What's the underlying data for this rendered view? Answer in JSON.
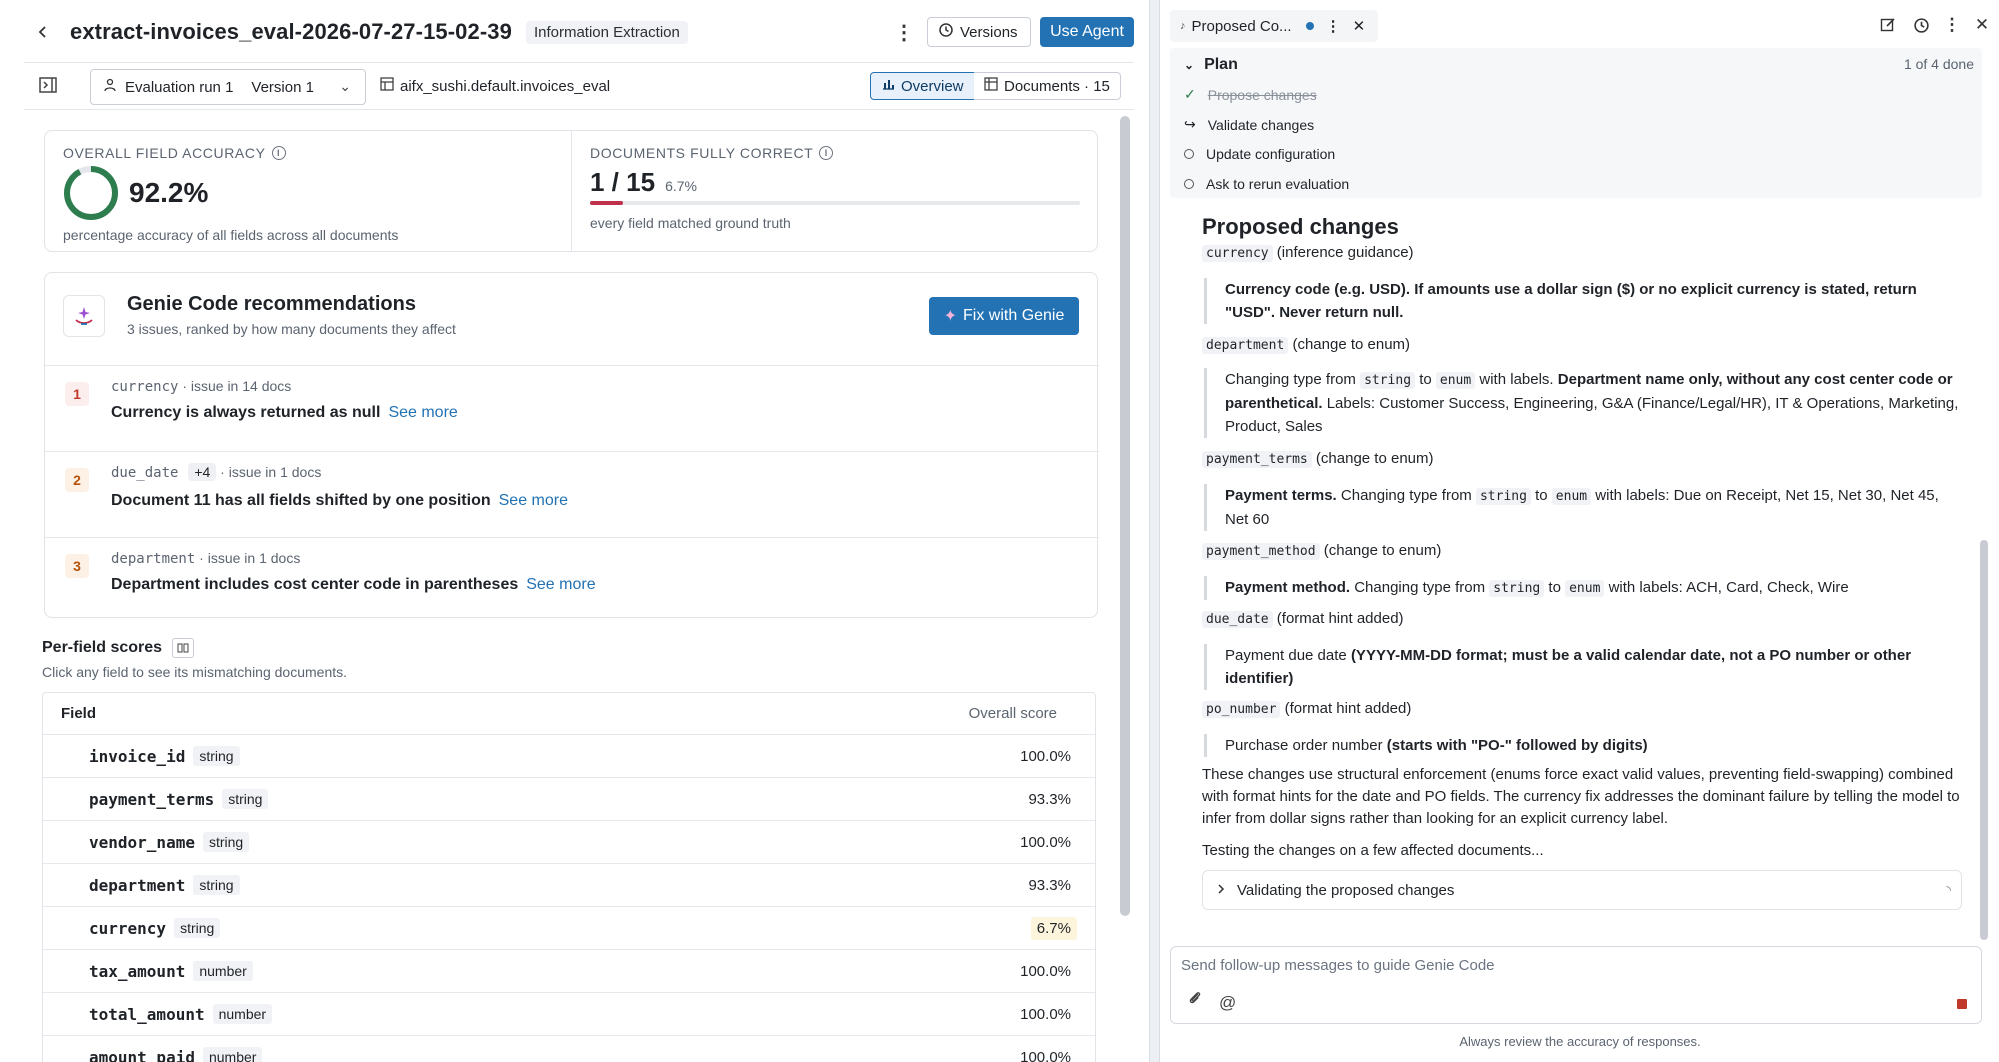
{
  "header": {
    "title": "extract-invoices_eval-2026-07-27-15-02-39",
    "tag": "Information Extraction",
    "versions_label": "Versions",
    "use_agent_label": "Use Agent"
  },
  "subbar": {
    "run_label": "Evaluation run 1",
    "version_label": "Version 1",
    "table_ref": "aifx_sushi.default.invoices_eval",
    "tab_overview": "Overview",
    "tab_documents": "Documents · 15"
  },
  "metrics": {
    "accuracy_label": "OVERALL FIELD ACCURACY",
    "accuracy_value": "92.2%",
    "accuracy_fraction": 0.922,
    "accuracy_caption": "percentage accuracy of all fields across all documents",
    "correct_label": "DOCUMENTS FULLY CORRECT",
    "correct_value": "1 / 15",
    "correct_pct": "6.7%",
    "correct_fraction": 0.067,
    "correct_caption": "every field matched ground truth"
  },
  "recommendations": {
    "title": "Genie Code recommendations",
    "subtitle": "3 issues, ranked by how many documents they affect",
    "fix_label": "Fix with Genie",
    "items": [
      {
        "num": "1",
        "field": "currency",
        "extra": "",
        "meta": " · issue in 14 docs",
        "title": "Currency is always returned as null",
        "see_more": "See more"
      },
      {
        "num": "2",
        "field": "due_date",
        "extra": "+4",
        "meta": " · issue in 1 docs",
        "title": "Document 11 has all fields shifted by one position",
        "see_more": "See more"
      },
      {
        "num": "3",
        "field": "department",
        "extra": "",
        "meta": " · issue in 1 docs",
        "title": "Department includes cost center code in parentheses",
        "see_more": "See more"
      }
    ]
  },
  "per_field": {
    "title": "Per-field scores",
    "subtitle": "Click any field to see its mismatching documents.",
    "col_field": "Field",
    "col_score": "Overall score",
    "rows": [
      {
        "name": "invoice_id",
        "type": "string",
        "score": "100.0%"
      },
      {
        "name": "payment_terms",
        "type": "string",
        "score": "93.3%"
      },
      {
        "name": "vendor_name",
        "type": "string",
        "score": "100.0%"
      },
      {
        "name": "department",
        "type": "string",
        "score": "93.3%"
      },
      {
        "name": "currency",
        "type": "string",
        "score": "6.7%"
      },
      {
        "name": "tax_amount",
        "type": "number",
        "score": "100.0%"
      },
      {
        "name": "total_amount",
        "type": "number",
        "score": "100.0%"
      },
      {
        "name": "amount_paid",
        "type": "number",
        "score": "100.0%"
      }
    ]
  },
  "assistant": {
    "tab_title": "Proposed Co...",
    "plan_title": "Plan",
    "plan_progress": "1 of 4 done",
    "plan_items": [
      "Propose changes",
      "Validate changes",
      "Update configuration",
      "Ask to rerun evaluation"
    ],
    "heading": "Proposed changes",
    "changes": {
      "currency_field": "currency",
      "currency_note": "(inference guidance)",
      "currency_quote": "Currency code (e.g. USD). If amounts use a dollar sign ($) or no explicit currency is stated, return \"USD\". Never return null.",
      "department_field": "department",
      "department_note": "(change to enum)",
      "department_q1": "Changing type from",
      "type_string": "string",
      "word_to": "to",
      "type_enum": "enum",
      "department_q2": "with labels.",
      "department_bold": "Department name only, without any cost center code or parenthetical.",
      "department_labels": "Labels: Customer Success, Engineering, G&A (Finance/Legal/HR), IT & Operations, Marketing, Product, Sales",
      "payment_terms_field": "payment_terms",
      "payment_terms_note": "(change to enum)",
      "payment_terms_bold": "Payment terms.",
      "payment_terms_labels": "with labels: Due on Receipt, Net 15, Net 30, Net 45, Net 60",
      "payment_method_field": "payment_method",
      "payment_method_note": "(change to enum)",
      "payment_method_bold": "Payment method.",
      "payment_method_labels": "with labels: ACH, Card, Check, Wire",
      "due_date_field": "due_date",
      "due_date_note": "(format hint added)",
      "due_date_plain": "Payment due date",
      "due_date_bold": "(YYYY-MM-DD format; must be a valid calendar date, not a PO number or other identifier)",
      "po_field": "po_number",
      "po_note": "(format hint added)",
      "po_plain": "Purchase order number",
      "po_bold": "(starts with \"PO-\" followed by digits)",
      "changing_type_from": "Changing type from"
    },
    "summary": "These changes use structural enforcement (enums force exact valid values, preventing field-swapping) combined with format hints for the date and PO fields. The currency fix addresses the dominant failure by telling the model to infer from dollar signs rather than looking for an explicit currency label.",
    "testing": "Testing the changes on a few affected documents...",
    "validating": "Validating the proposed changes",
    "composer_placeholder": "Send follow-up messages to guide Genie Code",
    "disclaimer": "Always review the accuracy of responses."
  }
}
